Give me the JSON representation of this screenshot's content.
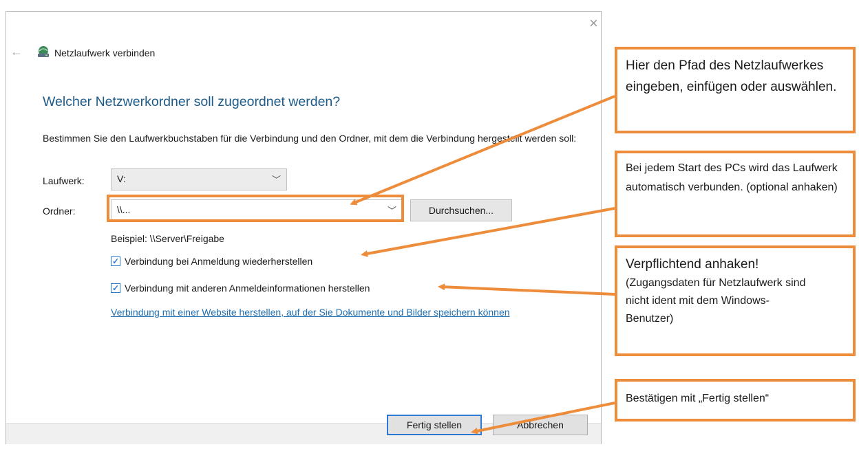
{
  "window": {
    "title": "Netzlaufwerk verbinden",
    "close_glyph": "×",
    "back_glyph": "←"
  },
  "dialog": {
    "heading": "Welcher Netzwerkordner soll zugeordnet werden?",
    "description": "Bestimmen Sie den Laufwerkbuchstaben für die Verbindung und den Ordner, mit dem die Verbindung hergestellt werden soll:",
    "drive": {
      "label": "Laufwerk:",
      "value": "V:"
    },
    "folder": {
      "label": "Ordner:",
      "value": "\\\\...",
      "browse_label": "Durchsuchen..."
    },
    "example": "Beispiel: \\\\Server\\Freigabe",
    "checkbox_reconnect": {
      "label": "Verbindung bei Anmeldung wiederherstellen",
      "checked": true
    },
    "checkbox_credentials": {
      "label": "Verbindung mit anderen Anmeldeinformationen herstellen",
      "checked": true
    },
    "website_link": "Verbindung mit einer Website herstellen, auf der Sie Dokumente und Bilder speichern können",
    "finish_label": "Fertig stellen",
    "cancel_label": "Abbrechen"
  },
  "annotations": {
    "path": "Hier den Pfad des Netzlaufwerkes eingeben, einfügen oder auswählen.",
    "reconnect": "Bei jedem Start des PCs wird das Laufwerk automatisch verbunden. (optional anhaken)",
    "credentials_title": "Verpflichtend anhaken!",
    "credentials_note": "(Zugangsdaten für Netzlaufwerk sind nicht ident mit dem Windows-Benutzer)",
    "finish": "Bestätigen mit „Fertig stellen“"
  },
  "colors": {
    "accent_orange": "#ed8c3a",
    "heading_blue": "#1c5a88",
    "link_blue": "#1f6fb0",
    "check_blue": "#2a7ad5"
  }
}
